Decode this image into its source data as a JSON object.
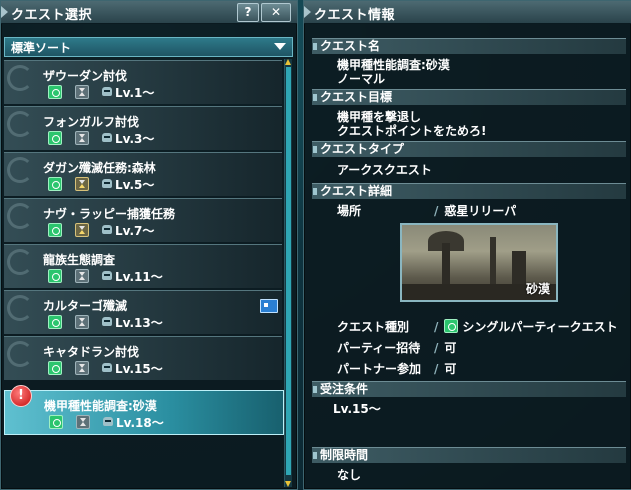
{
  "left_panel": {
    "title": "クエスト選択",
    "help_label": "?",
    "close_label": "✕",
    "sort_label": "標準ソート",
    "quests": [
      {
        "name": "ザウーダン討伐",
        "level": "Lv.1〜",
        "hourglass": "gray"
      },
      {
        "name": "フォンガルフ討伐",
        "level": "Lv.3〜",
        "hourglass": "gray"
      },
      {
        "name": "ダガン殲滅任務:森林",
        "level": "Lv.5〜",
        "hourglass": "gold"
      },
      {
        "name": "ナヴ・ラッピー捕獲任務",
        "level": "Lv.7〜",
        "hourglass": "gold"
      },
      {
        "name": "龍族生態調査",
        "level": "Lv.11〜",
        "hourglass": "gray"
      },
      {
        "name": "カルターゴ殲滅",
        "level": "Lv.13〜",
        "hourglass": "gray",
        "boost_icon": "boost-icon"
      },
      {
        "name": "キャタドラン討伐",
        "level": "Lv.15〜",
        "hourglass": "gray"
      },
      {
        "name": "機甲種性能調査:砂漠",
        "level": "Lv.18〜",
        "hourglass": "gray",
        "selected": true,
        "alert": "!"
      }
    ]
  },
  "right_panel": {
    "title": "クエスト情報",
    "name_header": "クエスト名",
    "name_line1": "機甲種性能調査:砂漠",
    "name_line2": "ノーマル",
    "goal_header": "クエスト目標",
    "goal_line1": "機甲種を撃退し",
    "goal_line2": "クエストポイントをためろ!",
    "type_header": "クエストタイプ",
    "type_value": "アークスクエスト",
    "detail_header": "クエスト詳細",
    "location_label": "場所",
    "location_value": "惑星リリーパ",
    "area_caption": "砂漠",
    "kind_label": "クエスト種別",
    "kind_value": "シングルパーティークエスト",
    "invite_label": "パーティー招待",
    "invite_value": "可",
    "partner_label": "パートナー参加",
    "partner_value": "可",
    "condition_header": "受注条件",
    "condition_value": "Lv.15〜",
    "time_header": "制限時間",
    "time_value": "なし",
    "slash": "/"
  }
}
